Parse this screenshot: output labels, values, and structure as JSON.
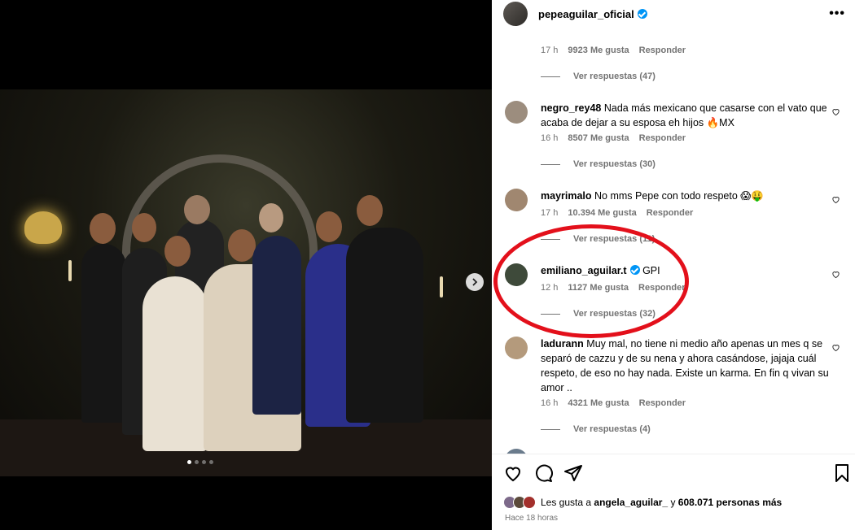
{
  "post_author": "pepeaguilar_oficial",
  "more_label": "•••",
  "comments": [
    {
      "username": "",
      "text": "",
      "time": "17 h",
      "likes": "9923 Me gusta",
      "reply": "Responder",
      "replies": "Ver respuestas (47)"
    },
    {
      "username": "negro_rey48",
      "text": "Nada más mexicano que casarse con el vato que acaba de dejar a su esposa eh hijos 🔥MX",
      "time": "16 h",
      "likes": "8507 Me gusta",
      "reply": "Responder",
      "replies": "Ver respuestas (30)"
    },
    {
      "username": "mayrimalo",
      "text": "No mms Pepe con todo respeto 😱🤑",
      "time": "17 h",
      "likes": "10.394 Me gusta",
      "reply": "Responder",
      "replies": "Ver respuestas (11)"
    },
    {
      "username": "emiliano_aguilar.t",
      "text": "GPI",
      "time": "12 h",
      "likes": "1127 Me gusta",
      "reply": "Responder",
      "replies": "Ver respuestas (32)"
    },
    {
      "username": "ladurann",
      "text": "Muy mal, no tiene ni medio año apenas un mes q se separó de cazzu y de su nena y ahora casándose, jajaja cuál respeto, de eso no hay nada. Existe un karma. En fin q vivan su amor ..",
      "time": "16 h",
      "likes": "4321 Me gusta",
      "reply": "Responder",
      "replies": "Ver respuestas (4)"
    }
  ],
  "likes_summary": {
    "prefix": "Les gusta a",
    "user": "angela_aguilar_",
    "connector": "y",
    "count": "608.071 personas más"
  },
  "posted_time": "Hace 18 horas",
  "colors": {
    "verified": "#0095f6",
    "highlight": "#e3101b",
    "meta": "#737373"
  },
  "icons": [
    "chevron-right-icon",
    "more-icon",
    "heart-icon",
    "comment-icon",
    "share-icon",
    "bookmark-icon",
    "verified-icon"
  ]
}
